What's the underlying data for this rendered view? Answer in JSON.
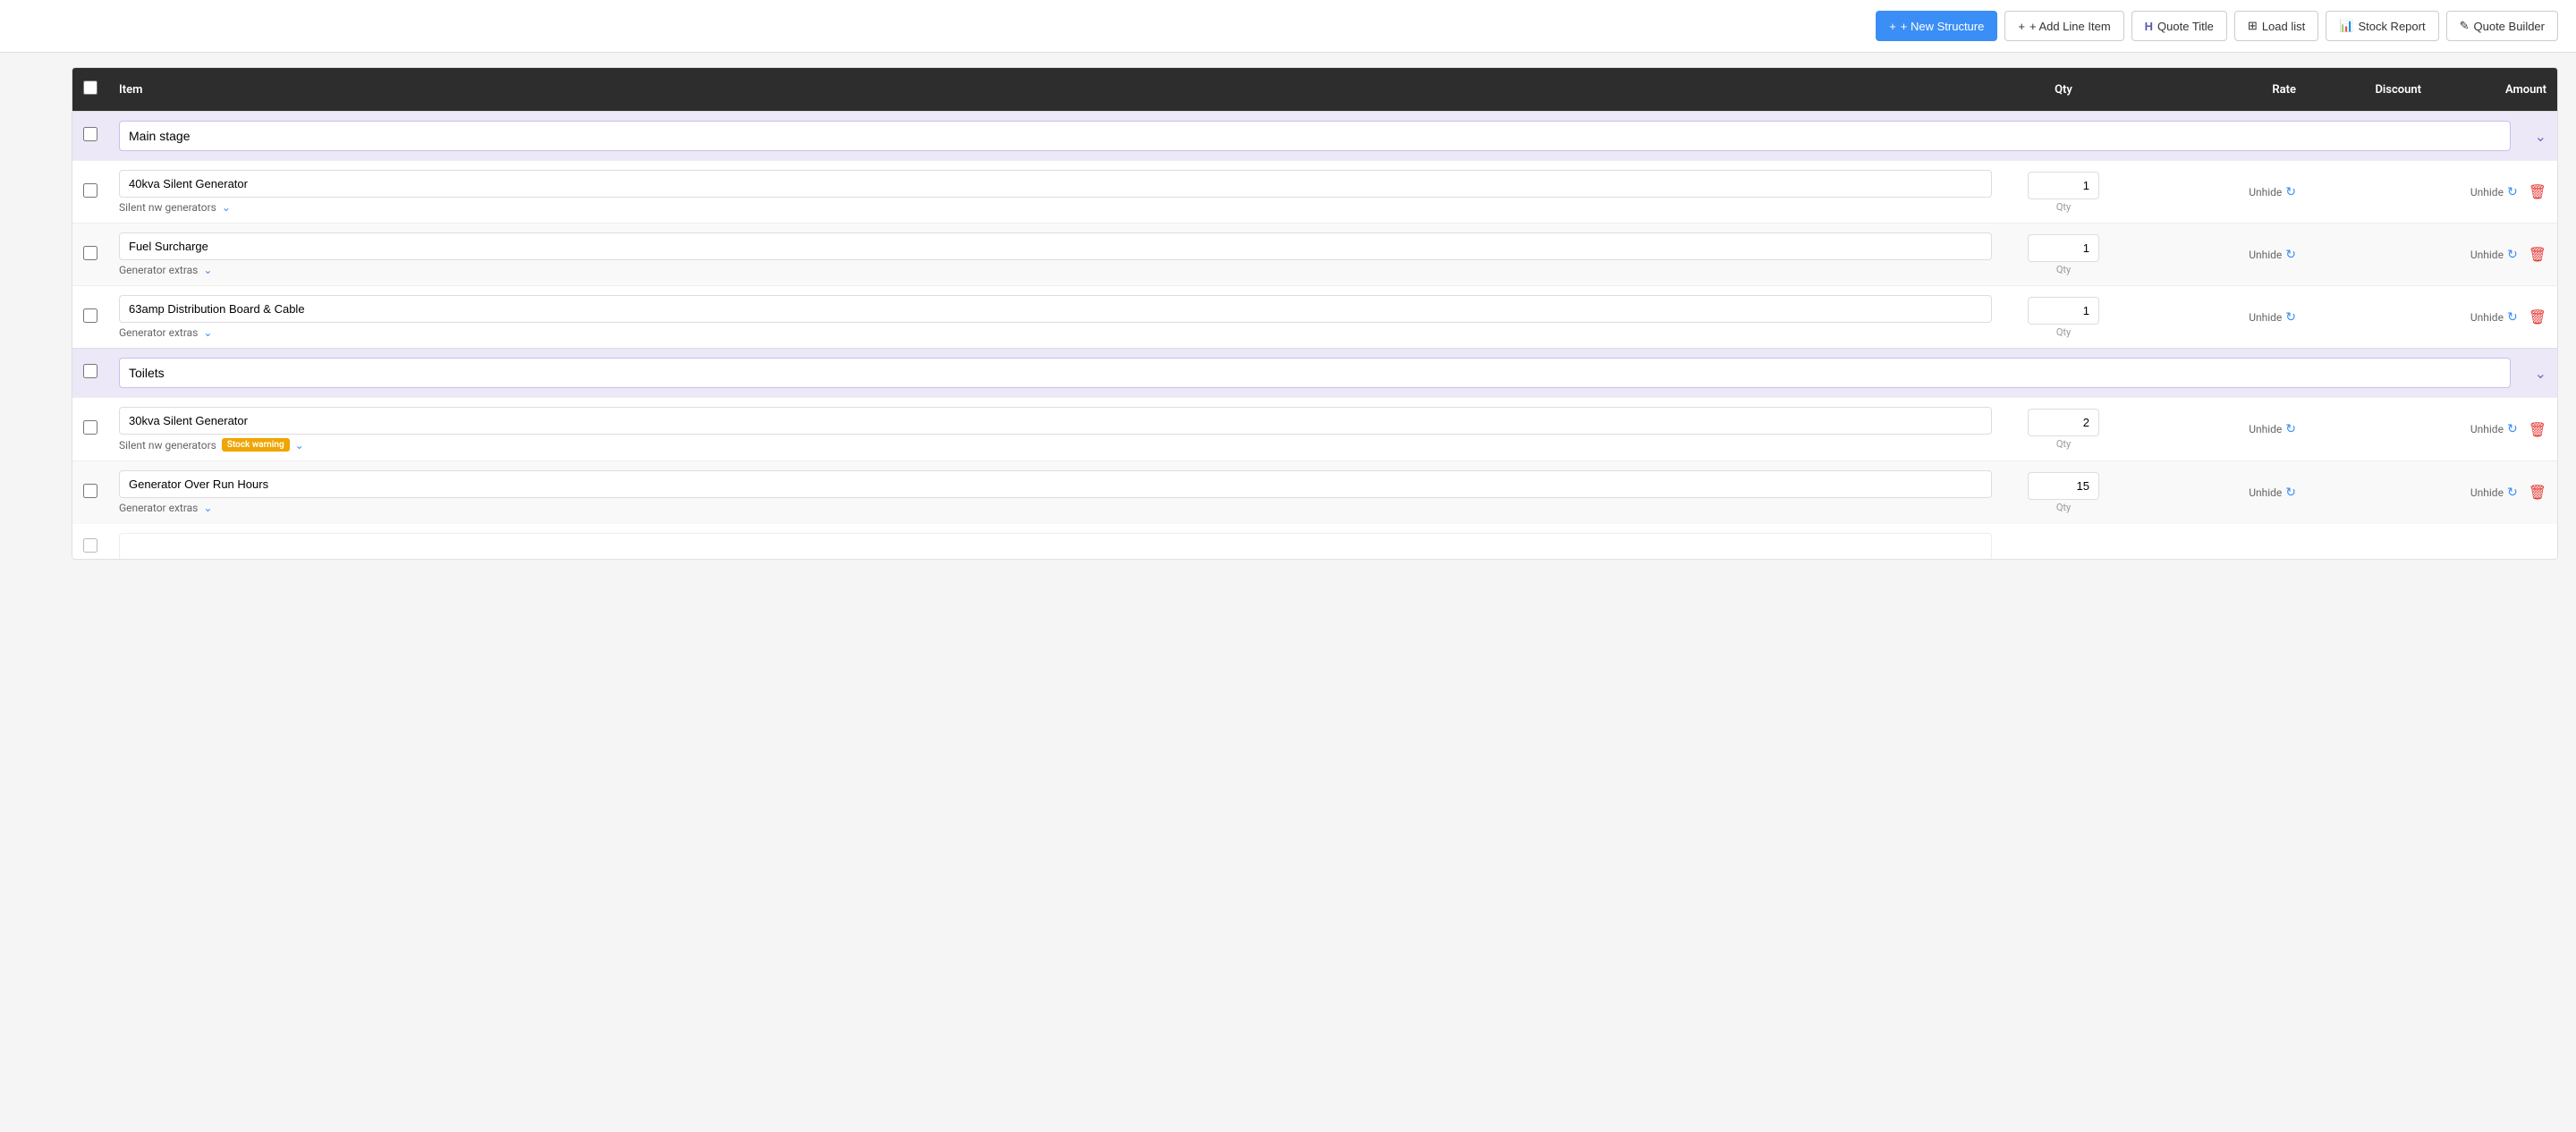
{
  "toolbar": {
    "new_structure_label": "+ New Structure",
    "add_line_item_label": "+ Add Line Item",
    "quote_title_label": "H  Quote Title",
    "load_list_label": "⊞  Load list",
    "stock_report_label": "⎕  Stock Report",
    "quote_builder_label": "✎  Quote Builder"
  },
  "table": {
    "headers": {
      "item": "Item",
      "qty": "Qty",
      "rate": "Rate",
      "discount": "Discount",
      "amount": "Amount"
    },
    "structures": [
      {
        "id": "structure-1",
        "name": "Main stage"
      },
      {
        "id": "structure-2",
        "name": "Toilets"
      }
    ],
    "line_items": [
      {
        "id": "item-1",
        "structure": "Main stage",
        "name": "40kva Silent Generator",
        "category": "Silent nw generators",
        "qty": "1",
        "qty_label": "Qty",
        "stock_warning": false,
        "alt": false
      },
      {
        "id": "item-2",
        "structure": "Main stage",
        "name": "Fuel Surcharge",
        "category": "Generator extras",
        "qty": "1",
        "qty_label": "Qty",
        "stock_warning": false,
        "alt": true
      },
      {
        "id": "item-3",
        "structure": "Main stage",
        "name": "63amp Distribution Board & Cable",
        "category": "Generator extras",
        "qty": "1",
        "qty_label": "Qty",
        "stock_warning": false,
        "alt": false
      },
      {
        "id": "item-4",
        "structure": "Toilets",
        "name": "30kva Silent Generator",
        "category": "Silent nw generators",
        "qty": "2",
        "qty_label": "Qty",
        "stock_warning": true,
        "stock_warning_label": "Stock warning",
        "alt": false
      },
      {
        "id": "item-5",
        "structure": "Toilets",
        "name": "Generator Over Run Hours",
        "category": "Generator extras",
        "qty": "15",
        "qty_label": "Qty",
        "stock_warning": false,
        "alt": true
      }
    ],
    "unhide_label": "Unhide",
    "refresh_symbol": "↻"
  }
}
